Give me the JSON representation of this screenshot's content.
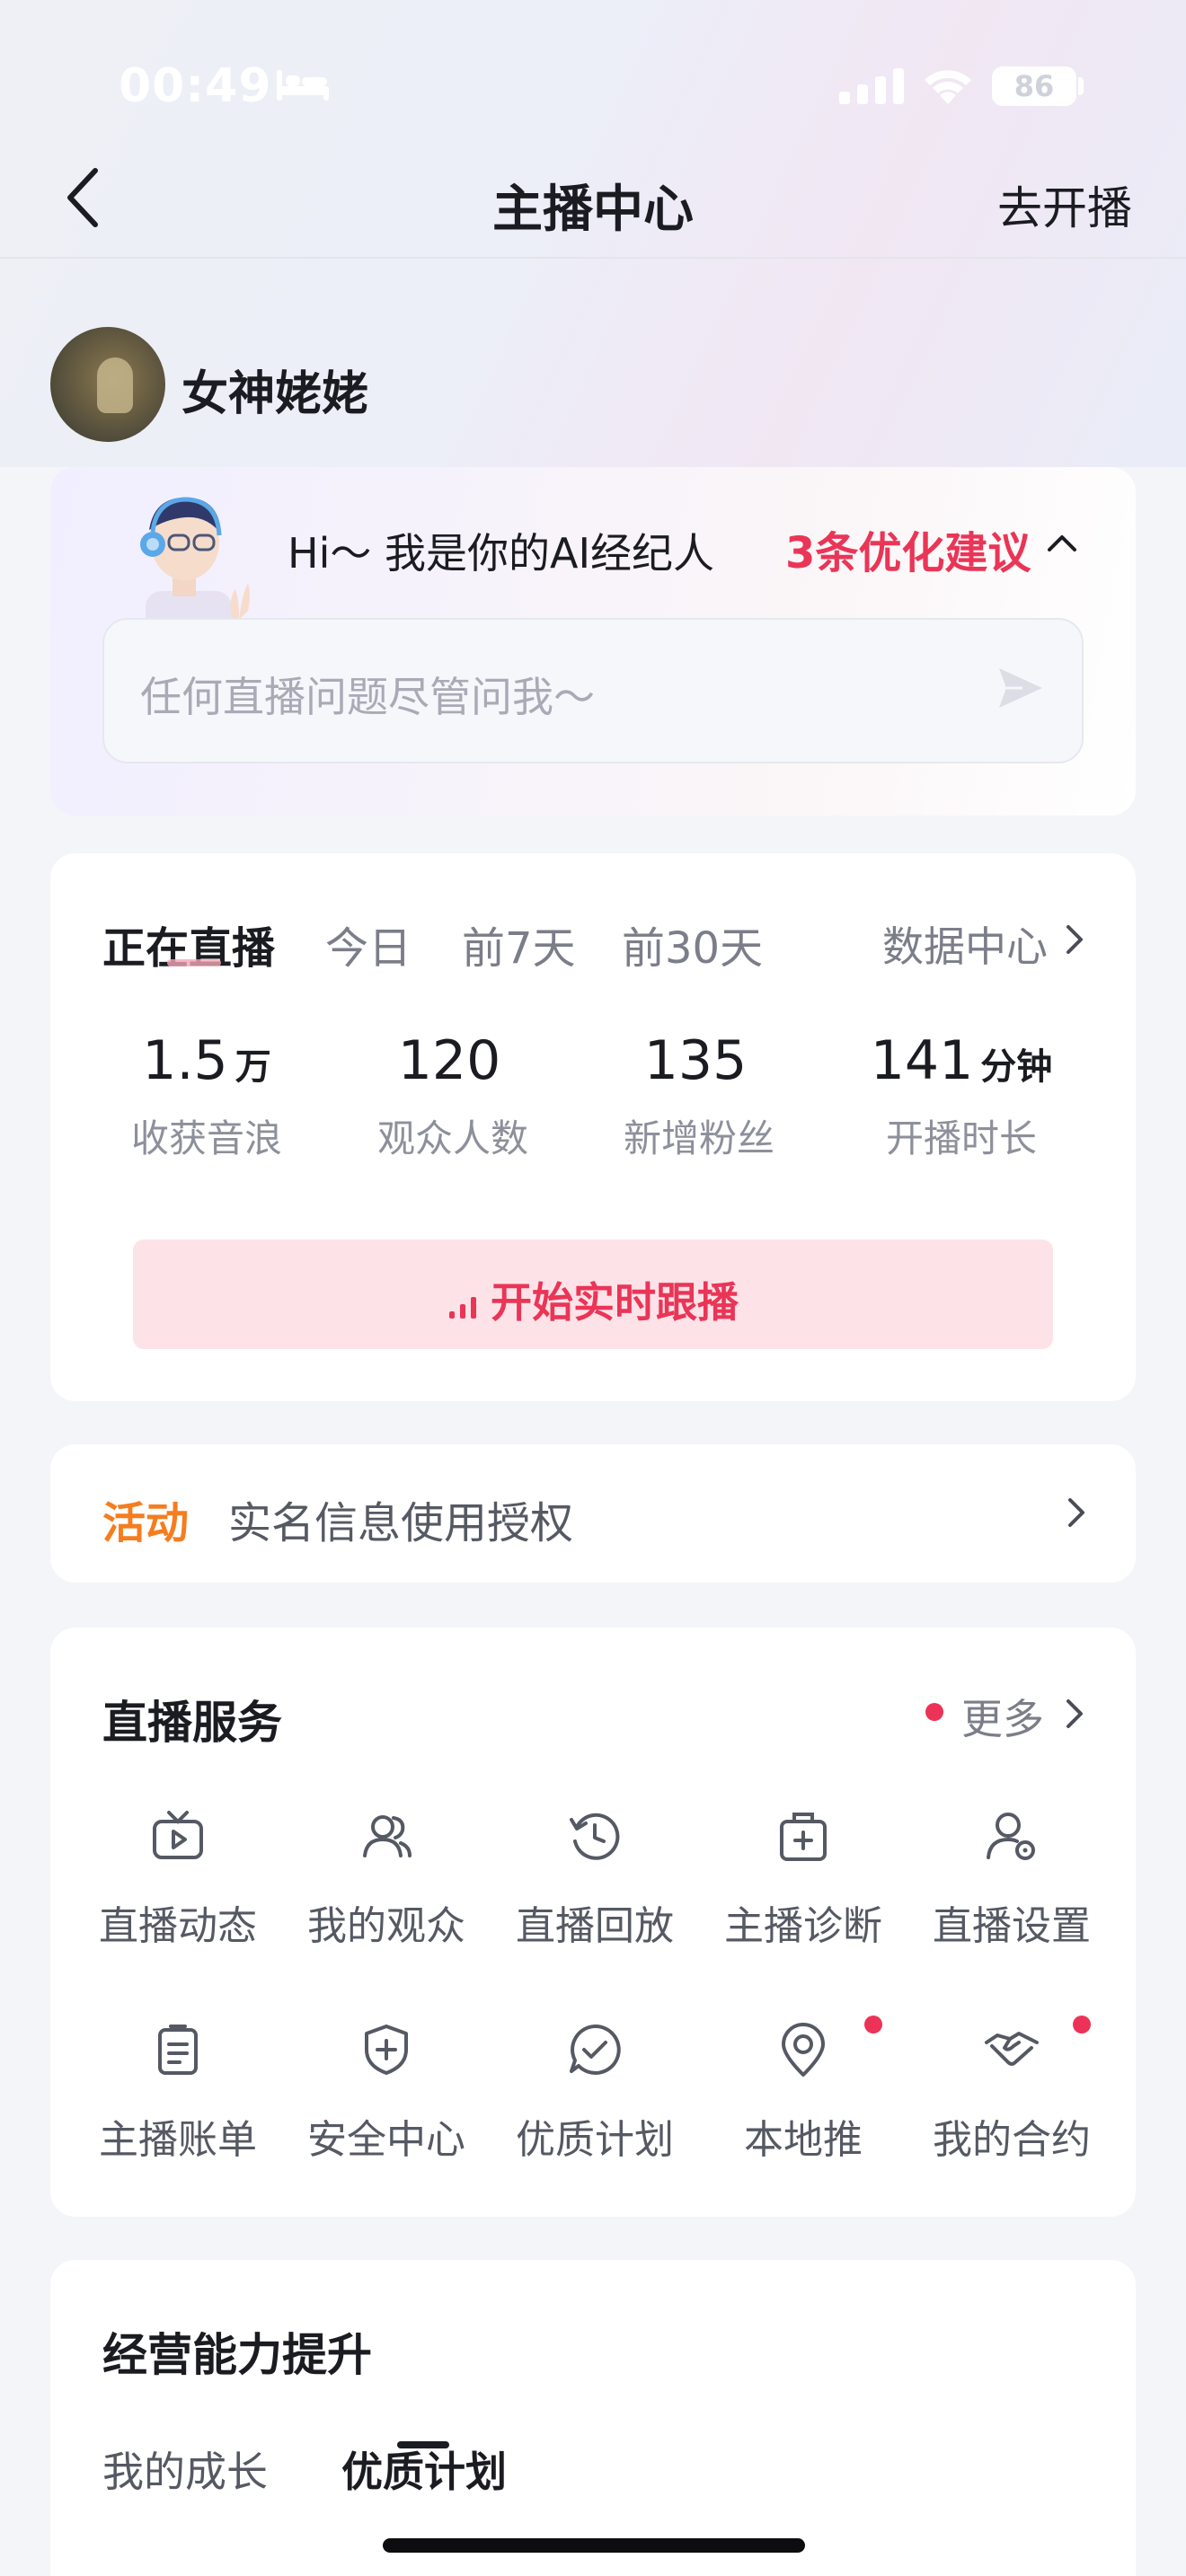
{
  "status_bar": {
    "time": "00:49",
    "battery": "86"
  },
  "nav": {
    "title": "主播中心",
    "action_label": "去开播"
  },
  "profile": {
    "username": "女神姥姥"
  },
  "ai_assistant": {
    "greeting": "Hi～ 我是你的AI经纪人",
    "suggestions": "3条优化建议",
    "input_placeholder": "任何直播问题尽管问我～"
  },
  "stats": {
    "tabs": [
      {
        "label": "正在直播",
        "active": true
      },
      {
        "label": "今日",
        "active": false
      },
      {
        "label": "前7天",
        "active": false
      },
      {
        "label": "前30天",
        "active": false
      }
    ],
    "data_center_label": "数据中心",
    "metrics": [
      {
        "value": "1.5",
        "unit": "万",
        "label": "收获音浪"
      },
      {
        "value": "120",
        "unit": "",
        "label": "观众人数"
      },
      {
        "value": "135",
        "unit": "",
        "label": "新增粉丝"
      },
      {
        "value": "141",
        "unit": "分钟",
        "label": "开播时长"
      }
    ],
    "track_button_label": "开始实时跟播"
  },
  "activity": {
    "tag": "活动",
    "text": "实名信息使用授权"
  },
  "services": {
    "title": "直播服务",
    "more_label": "更多",
    "items": [
      {
        "label": "直播动态",
        "icon": "tv-icon",
        "badge": false
      },
      {
        "label": "我的观众",
        "icon": "audience-icon",
        "badge": false
      },
      {
        "label": "直播回放",
        "icon": "replay-icon",
        "badge": false
      },
      {
        "label": "主播诊断",
        "icon": "medical-kit-icon",
        "badge": false
      },
      {
        "label": "直播设置",
        "icon": "user-settings-icon",
        "badge": false
      },
      {
        "label": "主播账单",
        "icon": "clipboard-icon",
        "badge": false
      },
      {
        "label": "安全中心",
        "icon": "shield-plus-icon",
        "badge": false
      },
      {
        "label": "优质计划",
        "icon": "check-chat-icon",
        "badge": false
      },
      {
        "label": "本地推",
        "icon": "location-pin-icon",
        "badge": true
      },
      {
        "label": "我的合约",
        "icon": "handshake-icon",
        "badge": true
      }
    ]
  },
  "growth": {
    "title": "经营能力提升",
    "tabs": [
      {
        "label": "我的成长",
        "active": false
      },
      {
        "label": "优质计划",
        "active": true
      }
    ]
  },
  "colors": {
    "accent_red": "#ea3557",
    "activity_orange": "#f57d1f",
    "track_button_bg": "#fde3e8",
    "text_primary": "#1b1c21",
    "text_secondary": "#7b7e89"
  }
}
